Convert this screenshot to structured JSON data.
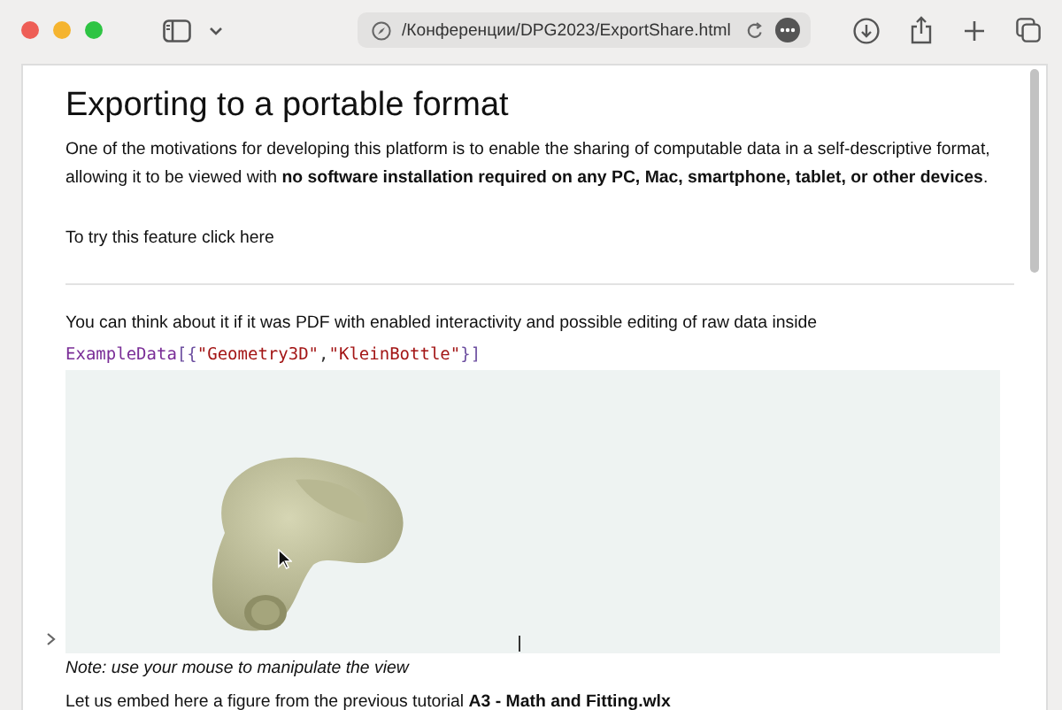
{
  "toolbar": {
    "url": "/Конференции/DPG2023/ExportShare.html"
  },
  "page": {
    "title": "Exporting to a portable format",
    "intro": "One of the motivations for developing this platform is to enable the sharing of computable data in a self-descriptive format, allowing it to be viewed with **no software installation required on any PC, Mac, smartphone, tablet, or other devices**.",
    "try_text": "To try this feature click here",
    "think_text": "You can think about it if it was PDF with enabled interactivity and possible editing of raw data inside",
    "code": [
      {
        "kind": "symbol",
        "text": "ExampleData"
      },
      {
        "kind": "bracket",
        "text": "[{"
      },
      {
        "kind": "string",
        "text": "\"Geometry3D\""
      },
      {
        "kind": "plain",
        "text": ","
      },
      {
        "kind": "string",
        "text": "\"KleinBottle\""
      },
      {
        "kind": "bracket",
        "text": "}]"
      }
    ],
    "output": {
      "kind": "graphics"
    },
    "note": "Note: use your mouse to manipulate the view",
    "embed_text": "Let us embed here a figure from the previous tutorial **A3 - Math and Fitting.wlx**"
  }
}
